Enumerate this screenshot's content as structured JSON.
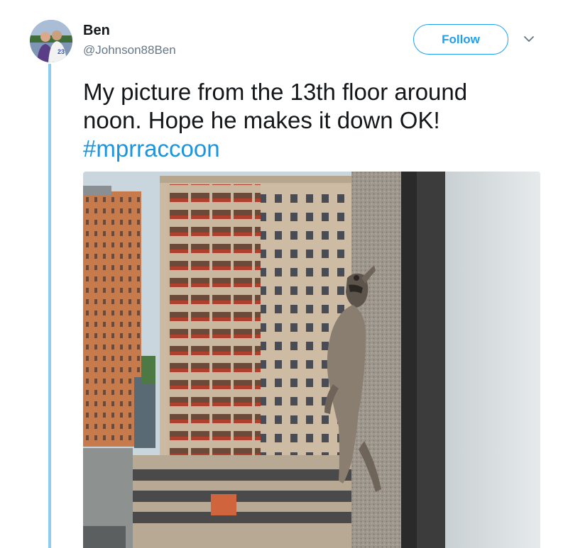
{
  "tweet": {
    "author": {
      "display_name": "Ben",
      "handle": "@Johnson88Ben"
    },
    "follow_label": "Follow",
    "text_line_1": "My picture from the 13th floor around",
    "text_line_2": "noon. Hope he makes it down OK!",
    "hashtag": "#mprraccoon"
  },
  "icons": {
    "menu": "chevron-down-icon"
  },
  "colors": {
    "accent": "#1da1f2",
    "hashtag": "#1b95e0",
    "thread_line": "#8ecdf0",
    "secondary_text": "#657786"
  }
}
